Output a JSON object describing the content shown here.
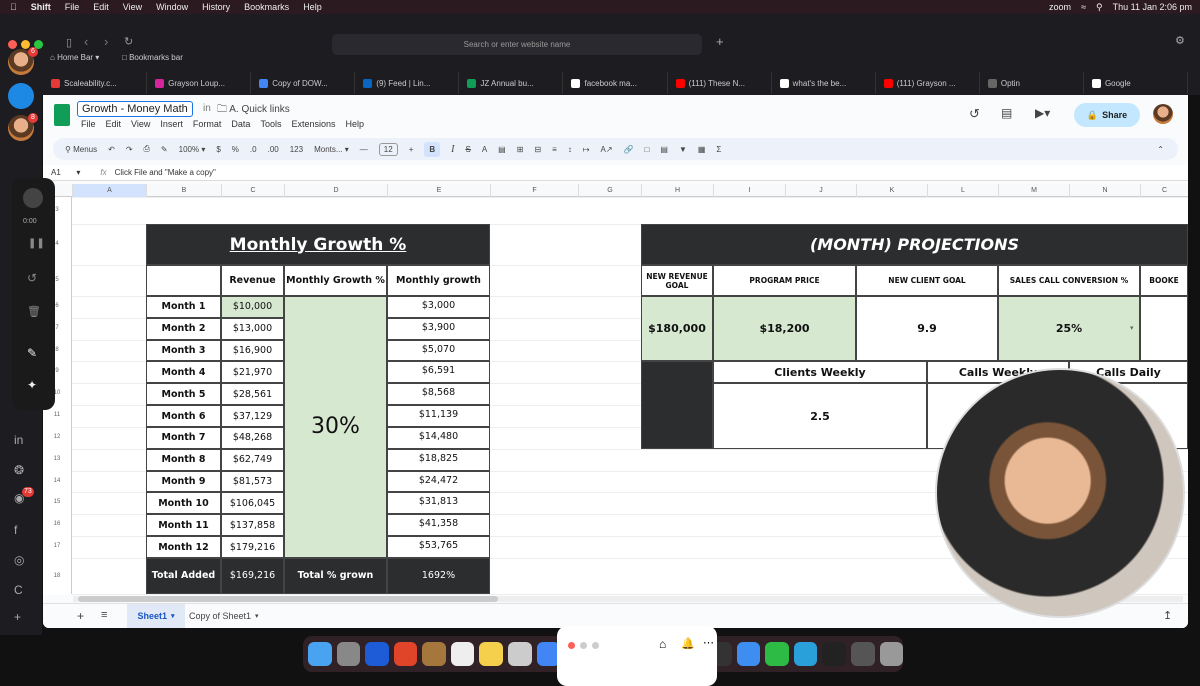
{
  "menubar": {
    "app": "Shift",
    "items": [
      "File",
      "Edit",
      "View",
      "Window",
      "History",
      "Bookmarks",
      "Help"
    ],
    "zoom": "zoom",
    "datetime": "Thu 11 Jan  2:06 pm"
  },
  "browser": {
    "address_placeholder": "Search or enter website name",
    "home_bar": "Home Bar",
    "bookmarks_bar": "Bookmarks bar",
    "tabs": [
      {
        "label": "Scaleability.c...",
        "color": "#e53935"
      },
      {
        "label": "Grayson Loup...",
        "color": "#d6249f"
      },
      {
        "label": "Copy of DOW...",
        "color": "#4285f4"
      },
      {
        "label": "(9) Feed | Lin...",
        "color": "#0a66c2"
      },
      {
        "label": "JZ Annual bu...",
        "color": "#0f9d58"
      },
      {
        "label": "facebook ma...",
        "color": "#ffffff"
      },
      {
        "label": "(111) These N...",
        "color": "#ff0000"
      },
      {
        "label": "what's the be...",
        "color": "#ffffff"
      },
      {
        "label": "(111) Grayson ...",
        "color": "#ff0000"
      },
      {
        "label": "Optin",
        "color": "#666666"
      },
      {
        "label": "Google",
        "color": "#ffffff"
      }
    ],
    "sidebar_badges": [
      "6",
      "8",
      "73"
    ]
  },
  "sheets": {
    "title": "Growth - Money Math",
    "in": "in",
    "folder": "A. Quick links",
    "share": "Share",
    "menu": [
      "File",
      "Edit",
      "View",
      "Insert",
      "Format",
      "Data",
      "Tools",
      "Extensions",
      "Help"
    ],
    "toolbar": {
      "search": "Menus",
      "zoom": "100%",
      "currency": "$",
      "percent": "%",
      "dec_less": ".0",
      "dec_more": ".00",
      "format123": "123",
      "font": "Monts...",
      "font_size": "12",
      "bold": "B",
      "italic": "I"
    },
    "cell_ref": "A1",
    "formula": "Click File and \"Make a copy\"",
    "columns": [
      "A",
      "B",
      "C",
      "D",
      "E",
      "F",
      "G",
      "H",
      "I",
      "J",
      "K",
      "L",
      "M",
      "N",
      "C"
    ],
    "rows": [
      "3",
      "4",
      "5",
      "6",
      "7",
      "8",
      "9",
      "10",
      "11",
      "12",
      "13",
      "14",
      "15",
      "16",
      "17",
      "18"
    ],
    "sheet_tabs": [
      "Sheet1",
      "Copy of Sheet1"
    ]
  },
  "growth_table": {
    "title": "Monthly Growth  %",
    "headers": [
      "Revenue",
      "Monthly Growth %",
      "Monthly growth"
    ],
    "rate": "30%",
    "rows": [
      [
        "Month 1",
        "$10,000",
        "$3,000"
      ],
      [
        "Month 2",
        "$13,000",
        "$3,900"
      ],
      [
        "Month 3",
        "$16,900",
        "$5,070"
      ],
      [
        "Month 4",
        "$21,970",
        "$6,591"
      ],
      [
        "Month 5",
        "$28,561",
        "$8,568"
      ],
      [
        "Month 6",
        "$37,129",
        "$11,139"
      ],
      [
        "Month 7",
        "$48,268",
        "$14,480"
      ],
      [
        "Month 8",
        "$62,749",
        "$18,825"
      ],
      [
        "Month 9",
        "$81,573",
        "$24,472"
      ],
      [
        "Month 10",
        "$106,045",
        "$31,813"
      ],
      [
        "Month 11",
        "$137,858",
        "$41,358"
      ],
      [
        "Month 12",
        "$179,216",
        "$53,765"
      ]
    ],
    "footer": [
      "Total Added",
      "$169,216",
      "Total % grown",
      "1692%"
    ]
  },
  "projections": {
    "title": "(MONTH) PROJECTIONS",
    "headers": [
      "NEW REVENUE GOAL",
      "PROGRAM PRICE",
      "NEW CLIENT GOAL",
      "SALES CALL CONVERSION %",
      "BOOKE"
    ],
    "values": [
      "$180,000",
      "$18,200",
      "9.9",
      "25%",
      ""
    ],
    "sub_headers": [
      "Clients Weekly",
      "Calls Weekly",
      "Calls Daily"
    ],
    "sub_values": [
      "2.5"
    ]
  },
  "recorder": {
    "time": "0:00"
  }
}
